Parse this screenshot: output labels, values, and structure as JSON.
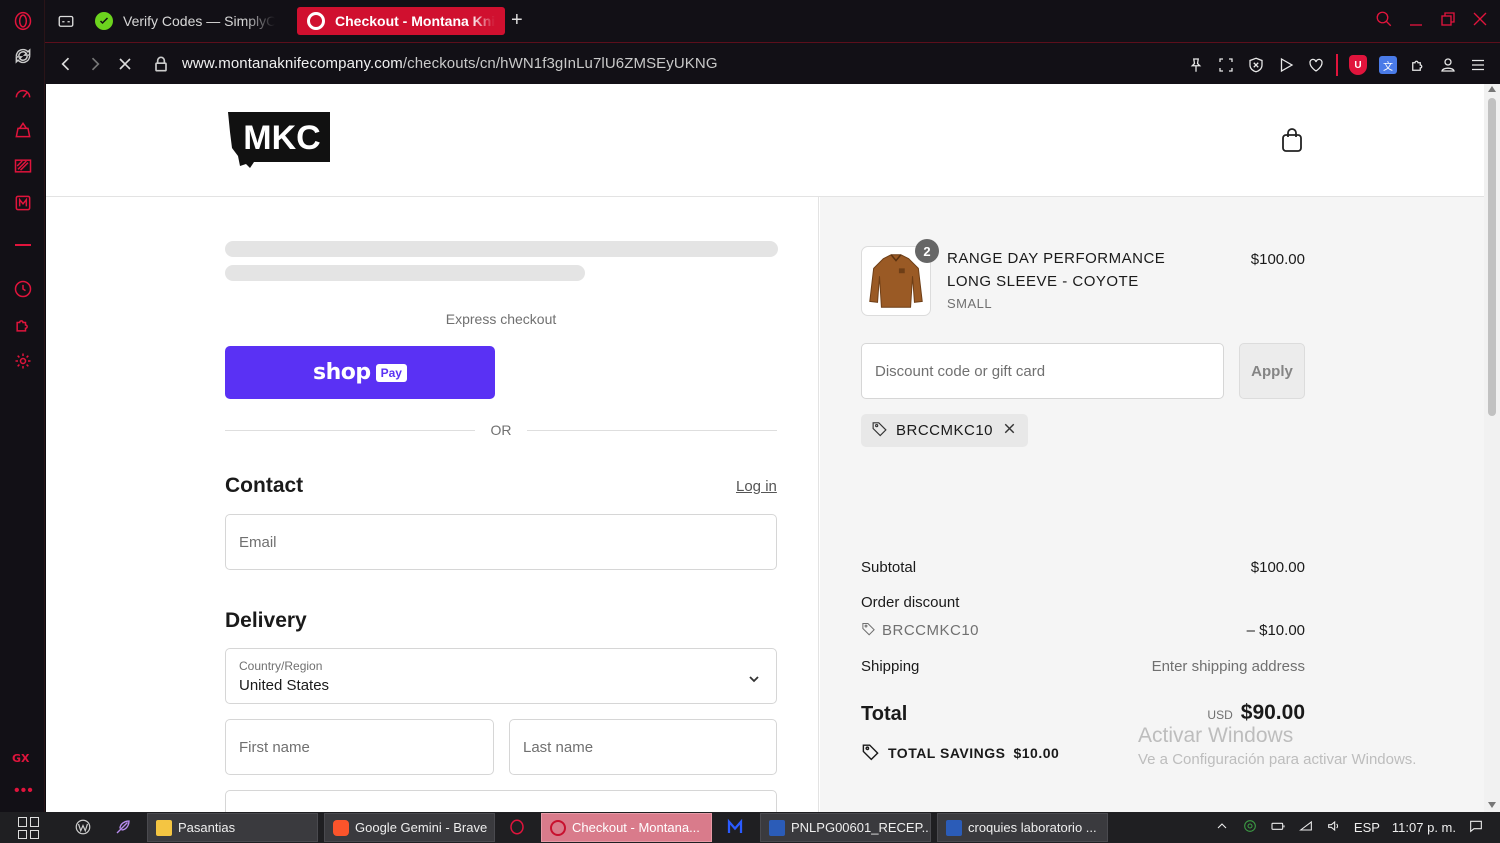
{
  "browser": {
    "tabs": [
      {
        "label": "Verify Codes — SimplyCodes",
        "active": false
      },
      {
        "label": "Checkout - Montana Knife Company",
        "active": true
      }
    ],
    "new_tab": "+",
    "url_host": "www.montanaknifecompany.com",
    "url_path": "/checkouts/cn/hWN1f3gInLu7lU6ZMSEyUKNG",
    "sidebar_gx": "GX",
    "sidebar_more": "•••",
    "accent": "#e0143c"
  },
  "site": {
    "logo_text": "MKC"
  },
  "checkout": {
    "express_label": "Express checkout",
    "shoppay_shop": "shop",
    "shoppay_pay": "Pay",
    "or_label": "OR",
    "contact_title": "Contact",
    "login_link": "Log in",
    "email_placeholder": "Email",
    "delivery_title": "Delivery",
    "country_label": "Country/Region",
    "country_value": "United States",
    "first_name_placeholder": "First name",
    "last_name_placeholder": "Last name"
  },
  "summary": {
    "quantity": "2",
    "product_name": "RANGE DAY PERFORMANCE LONG SLEEVE - COYOTE",
    "product_variant": "SMALL",
    "product_price": "$100.00",
    "discount_placeholder": "Discount code or gift card",
    "apply_label": "Apply",
    "applied_code": "BRCCMKC10",
    "subtotal_label": "Subtotal",
    "subtotal_value": "$100.00",
    "order_discount_label": "Order discount",
    "order_discount_code": "BRCCMKC10",
    "order_discount_value": "– $10.00",
    "shipping_label": "Shipping",
    "shipping_value": "Enter shipping address",
    "total_label": "Total",
    "total_currency": "USD",
    "total_value": "$90.00",
    "savings_label": "TOTAL SAVINGS",
    "savings_value": "$10.00"
  },
  "watermark": {
    "line1": "Activar Windows",
    "line2": "Ve a Configuración para activar Windows."
  },
  "taskbar": {
    "tasks": [
      {
        "label": "Pasantias"
      },
      {
        "label": "Google Gemini - Brave"
      },
      {
        "label": "Checkout - Montana..."
      },
      {
        "label": "PNLPG00601_RECEP..."
      },
      {
        "label": "croquies laboratorio ..."
      }
    ],
    "language": "ESP",
    "time": "11:07 p. m."
  }
}
